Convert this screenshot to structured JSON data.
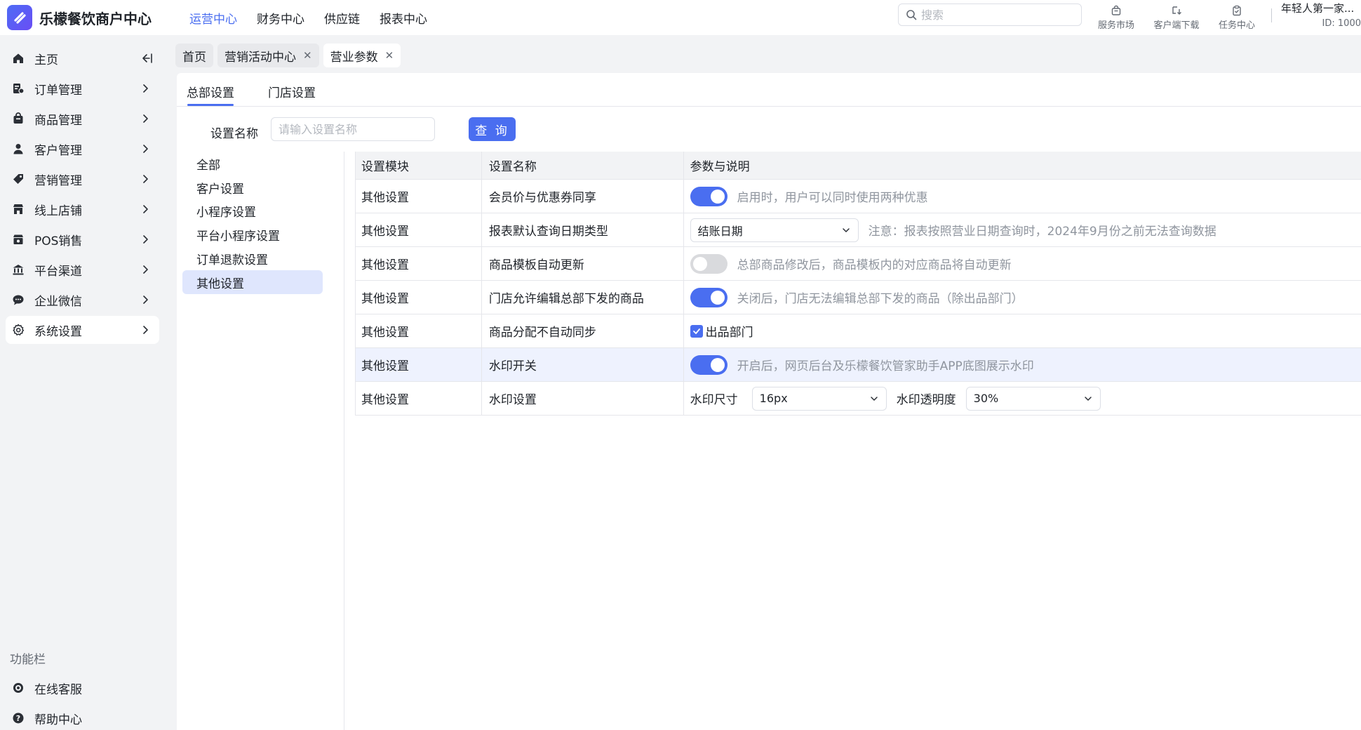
{
  "app": {
    "title": "乐檬餐饮商户中心"
  },
  "topnav": [
    {
      "label": "运营中心",
      "active": true
    },
    {
      "label": "财务中心"
    },
    {
      "label": "供应链"
    },
    {
      "label": "报表中心"
    }
  ],
  "search": {
    "placeholder": "搜索"
  },
  "tools": [
    {
      "label": "服务市场",
      "icon": "shopping-bag-icon"
    },
    {
      "label": "客户端下载",
      "icon": "download-icon"
    },
    {
      "label": "任务中心",
      "icon": "clipboard-icon"
    }
  ],
  "account": {
    "name": "年轻人第一家...",
    "id": "ID: 1000"
  },
  "sidebar": {
    "items": [
      {
        "label": "主页",
        "icon": "home-icon"
      },
      {
        "label": "订单管理",
        "icon": "order-icon"
      },
      {
        "label": "商品管理",
        "icon": "goods-icon"
      },
      {
        "label": "客户管理",
        "icon": "user-icon"
      },
      {
        "label": "营销管理",
        "icon": "tag-icon"
      },
      {
        "label": "线上店铺",
        "icon": "store-icon"
      },
      {
        "label": "POS销售",
        "icon": "pos-icon"
      },
      {
        "label": "平台渠道",
        "icon": "bank-icon"
      },
      {
        "label": "企业微信",
        "icon": "chat-icon"
      },
      {
        "label": "系统设置",
        "icon": "gear-icon",
        "active": true
      }
    ],
    "func_title": "功能栏",
    "func_items": [
      {
        "label": "在线客服",
        "icon": "headset-icon"
      },
      {
        "label": "帮助中心",
        "icon": "help-icon"
      }
    ]
  },
  "page_tabs": [
    {
      "label": "首页"
    },
    {
      "label": "营销活动中心",
      "closable": true
    },
    {
      "label": "营业参数",
      "closable": true,
      "active": true
    }
  ],
  "subtabs": [
    {
      "label": "总部设置",
      "active": true
    },
    {
      "label": "门店设置"
    }
  ],
  "filter": {
    "label": "设置名称",
    "placeholder": "请输入设置名称",
    "button": "查 询"
  },
  "categories": [
    {
      "label": "全部"
    },
    {
      "label": "客户设置"
    },
    {
      "label": "小程序设置"
    },
    {
      "label": "平台小程序设置"
    },
    {
      "label": "订单退款设置"
    },
    {
      "label": "其他设置",
      "active": true
    }
  ],
  "table": {
    "headers": [
      "设置模块",
      "设置名称",
      "参数与说明"
    ],
    "rows": [
      {
        "module": "其他设置",
        "name": "会员价与优惠券同享",
        "switch_on": true,
        "desc": "启用时，用户可以同时使用两种优惠"
      },
      {
        "module": "其他设置",
        "name": "报表默认查询日期类型",
        "select_value": "结账日期",
        "desc": "注意：报表按照营业日期查询时，2024年9月份之前无法查询数据"
      },
      {
        "module": "其他设置",
        "name": "商品模板自动更新",
        "switch_on": false,
        "desc": "总部商品修改后，商品模板内的对应商品将自动更新"
      },
      {
        "module": "其他设置",
        "name": "门店允许编辑总部下发的商品",
        "switch_on": true,
        "desc": "关闭后，门店无法编辑总部下发的商品（除出品部门）"
      },
      {
        "module": "其他设置",
        "name": "商品分配不自动同步",
        "checkbox_checked": true,
        "checkbox_label": "出品部门"
      },
      {
        "module": "其他设置",
        "name": "水印开关",
        "switch_on": true,
        "desc": "开启后，网页后台及乐檬餐饮管家助手APP底图展示水印",
        "highlighted": true
      },
      {
        "module": "其他设置",
        "name": "水印设置",
        "size_label": "水印尺寸",
        "size_value": "16px",
        "opacity_label": "水印透明度",
        "opacity_value": "30%"
      }
    ]
  },
  "colors": {
    "accent": "#4a6ef0",
    "selected_bg": "#dfe6fd",
    "row_highlight": "#eef2fe"
  }
}
